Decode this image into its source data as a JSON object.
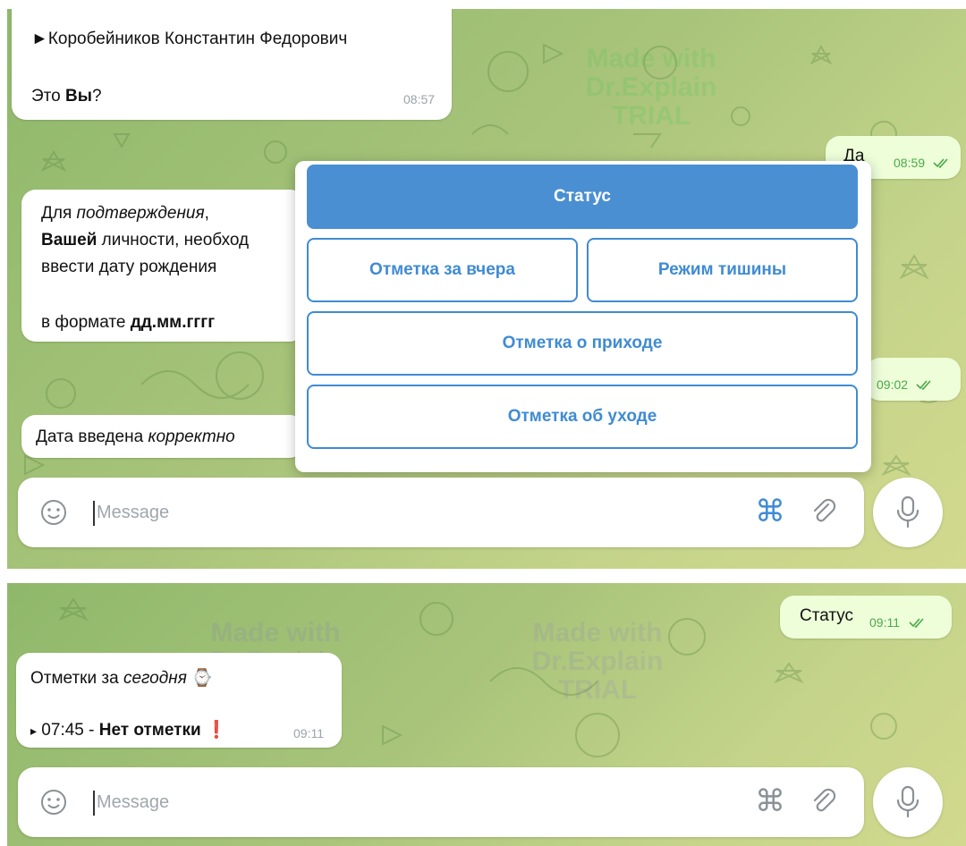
{
  "top": {
    "msg_user": {
      "arrow": "►",
      "name": "Коробейников Константин Федорович",
      "q_prefix": "Это ",
      "q_bold": "Вы",
      "q_suffix": "?",
      "time": "08:57"
    },
    "msg_out1": {
      "text": "Да",
      "time": "08:59"
    },
    "msg_confirm": {
      "l1_prefix": "Для ",
      "l1_italic": "подтверждения",
      "l1_suffix": ",",
      "l2_bold": "Вашей",
      "l2_rest": " личности, необход",
      "l3": "ввести дату рождения",
      "l4_prefix": "в формате ",
      "l4_bold": "дд.мм.гггг"
    },
    "msg_out2": {
      "time": "09:02"
    },
    "msg_date": {
      "prefix": "Дата введена ",
      "italic": "корректно"
    },
    "keyboard": {
      "status": "Статус",
      "yesterday": "Отметка за вчера",
      "silent": "Режим тишины",
      "arrival": "Отметка о приходе",
      "departure": "Отметка об уходе"
    },
    "input": {
      "placeholder": "Message"
    }
  },
  "bottom": {
    "msg_out": {
      "text": "Статус",
      "time": "09:11"
    },
    "msg_marks": {
      "l1_prefix": "Отметки за ",
      "l1_italic": "сегодня",
      "l1_emoji": "⌚",
      "l2_bullet": "▸",
      "l2_time": " 07:45 - ",
      "l2_bold": "Нет отметки",
      "l2_emoji": "❗",
      "time": "09:11"
    },
    "input": {
      "placeholder": "Message"
    }
  },
  "watermark": {
    "line1": "Made with",
    "line2": "Dr.Explain",
    "line3": "TRIAL"
  },
  "icons": {
    "emoji": "smiley-icon",
    "commands": "command-icon",
    "attach": "paperclip-icon",
    "mic": "microphone-icon",
    "read": "double-check-icon"
  },
  "colors": {
    "accent": "#3f8bd3",
    "outgoing_bubble": "#eefed9",
    "read_tick": "#4aa84a"
  }
}
